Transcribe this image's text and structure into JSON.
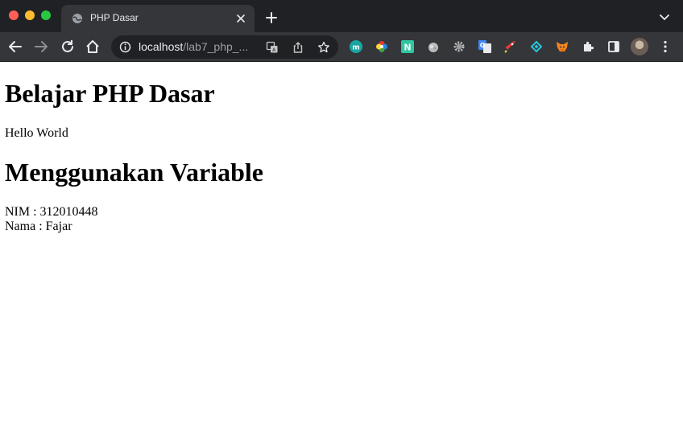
{
  "window": {
    "traffic_lights": {
      "close": "#ff5f57",
      "minimize": "#febc2e",
      "zoom": "#28c840"
    }
  },
  "tab": {
    "title": "PHP Dasar",
    "favicon": "globe-icon",
    "close": "close-icon"
  },
  "toolbar": {
    "buttons": [
      "back-arrow-icon",
      "forward-arrow-icon",
      "reload-icon",
      "home-icon"
    ],
    "omnibox": {
      "host": "localhost",
      "path": "/lab7_php_...",
      "actions": [
        "translate-icon",
        "share-icon",
        "bookmark-star-icon"
      ]
    },
    "extensions": [
      "extension-m-icon",
      "extension-color-wheel-icon",
      "extension-n-icon",
      "extension-cloud-icon",
      "extension-gear-icon",
      "extension-google-translate-icon",
      "extension-rocket-icon",
      "extension-diamond-icon",
      "extension-fox-icon",
      "extensions-puzzle-icon",
      "side-panel-icon"
    ],
    "profile": "avatar",
    "menu": "menu-dots-icon"
  },
  "page": {
    "heading1": "Belajar PHP Dasar",
    "text1": "Hello World",
    "heading2": "Menggunakan Variable",
    "nim": "NIM : 312010448",
    "nama": "Nama : Fajar"
  }
}
